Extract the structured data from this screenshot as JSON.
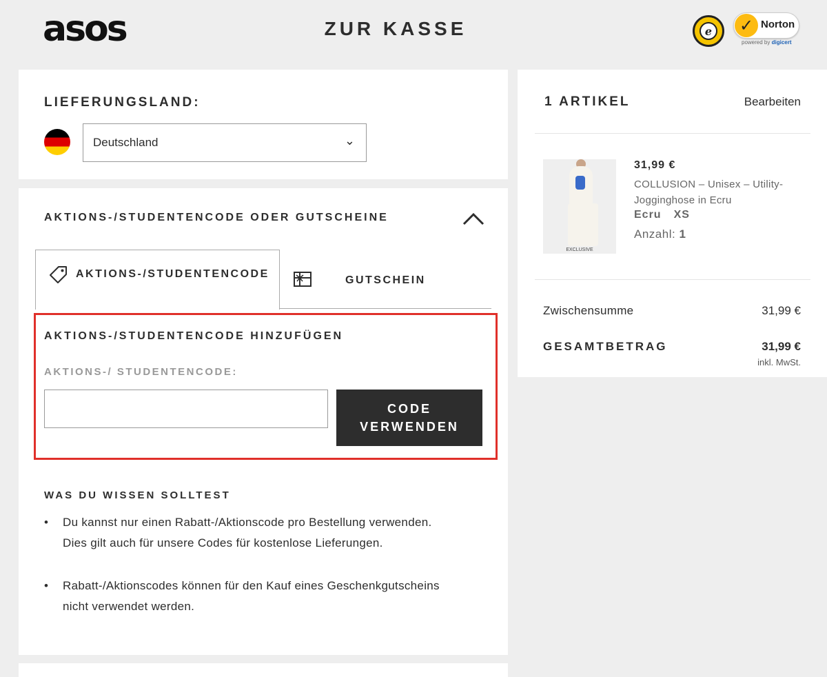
{
  "header": {
    "logo": "asos",
    "title": "ZUR KASSE",
    "trust_badges": [
      "trusted-shops-icon",
      "norton-icon"
    ],
    "norton_name": "Norton",
    "norton_powered": "powered by",
    "norton_powered_brand": "digicert"
  },
  "country": {
    "label": "LIEFERUNGSLAND:",
    "flag": "germany-flag-icon",
    "selected": "Deutschland"
  },
  "promo": {
    "section_title": "AKTIONS-/STUDENTENCODE ODER GUTSCHEINE",
    "tabs": [
      {
        "label": "AKTIONS-/STUDENTENCODE",
        "icon": "tag-icon",
        "active": true
      },
      {
        "label": "GUTSCHEIN",
        "icon": "gift-card-icon",
        "active": false
      }
    ],
    "add_title": "AKTIONS-/STUDENTENCODE HINZUFÜGEN",
    "field_label": "AKTIONS-/ STUDENTENCODE:",
    "input_value": "",
    "button_label_line1": "CODE",
    "button_label_line2": "VERWENDEN",
    "highlight_color": "#e0302a"
  },
  "info": {
    "title": "WAS DU WISSEN SOLLTEST",
    "bullets": [
      {
        "line1": "Du kannst nur einen Rabatt-/Aktionscode pro Bestellung verwenden.",
        "line2": "Dies gilt auch für unsere Codes für kostenlose Lieferungen."
      },
      {
        "line1": "Rabatt-/Aktionscodes können für den Kauf eines Geschenkgutscheins",
        "line2": "nicht verwendet werden."
      }
    ]
  },
  "summary": {
    "count_label": "1 ARTIKEL",
    "edit_label": "Bearbeiten",
    "item": {
      "price": "31,99 €",
      "name": "COLLUSION – Unisex – Utility-Jogginghose in Ecru",
      "color": "Ecru",
      "size": "XS",
      "qty_label": "Anzahl:",
      "qty": "1",
      "image_tag": "EXCLUSIVE"
    },
    "subtotal_label": "Zwischensumme",
    "subtotal_value": "31,99 €",
    "total_label": "GESAMTBETRAG",
    "total_value": "31,99 €",
    "vat_note": "inkl. MwSt."
  },
  "colors": {
    "background": "#eeeeee",
    "text": "#2d2d2d",
    "button": "#2d2d2d",
    "accent_highlight": "#e0302a"
  }
}
